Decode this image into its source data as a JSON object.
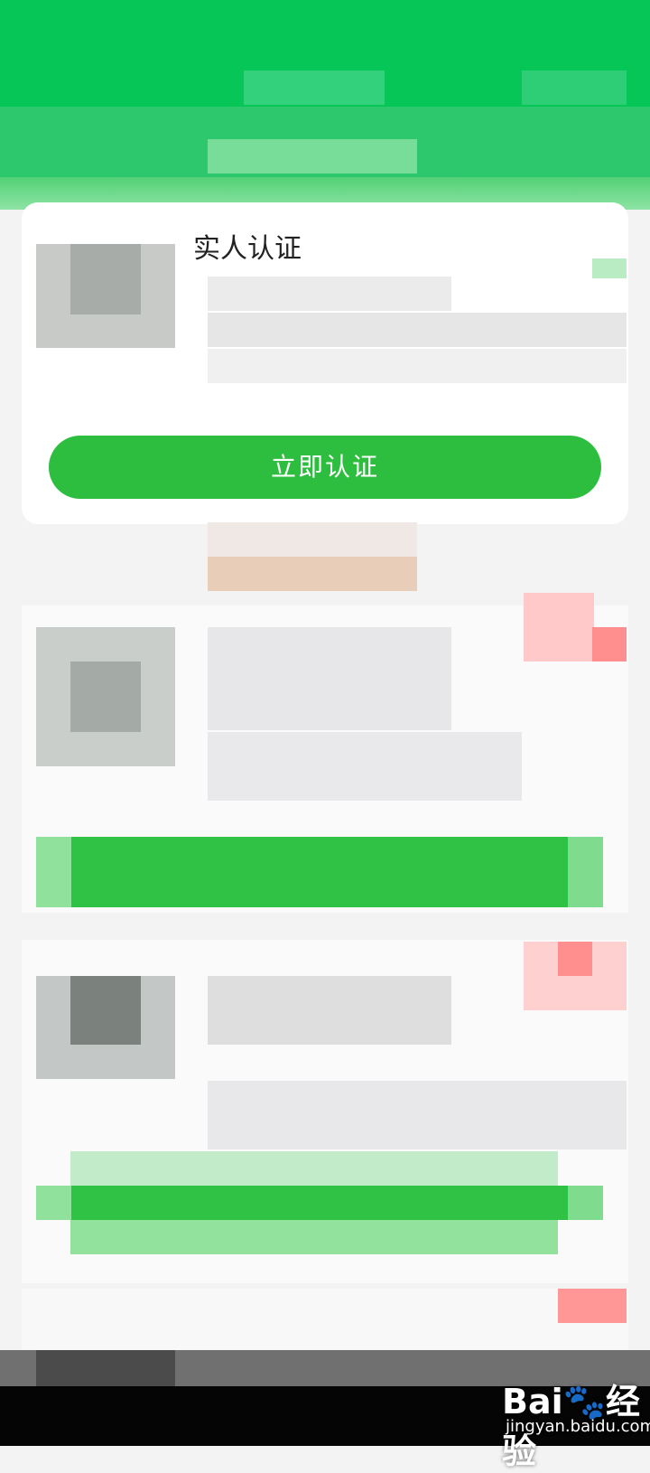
{
  "verify_card": {
    "title": "实人认证",
    "button_label": "立即认证"
  },
  "watermark": {
    "logo_text": "Bai🐾经验",
    "url_text": "jingyan.baidu.com"
  },
  "colors": {
    "header_green": "#05c657",
    "button_green": "#2dbd3f",
    "background": "#f3f3f3",
    "badge_red": "#ff8f8f"
  },
  "icons": {
    "watermark": "baidu-paw-icon"
  }
}
